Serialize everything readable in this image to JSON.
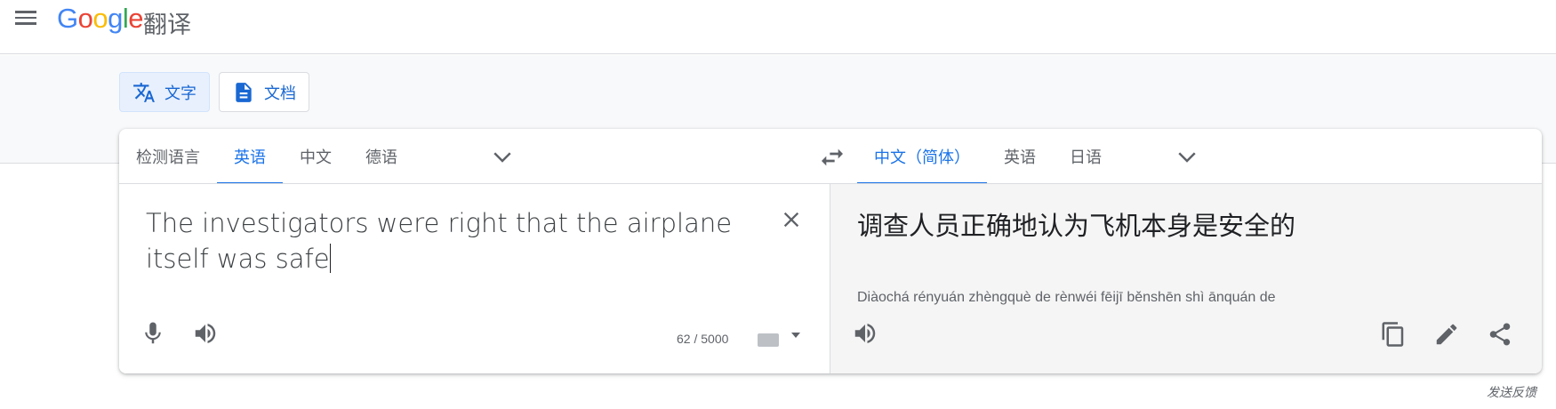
{
  "header": {
    "logo_text": "Google",
    "logo_letters": [
      "G",
      "o",
      "o",
      "g",
      "l",
      "e"
    ],
    "product_name": "翻译"
  },
  "modes": {
    "text_label": "文字",
    "document_label": "文档"
  },
  "source": {
    "languages": [
      "检测语言",
      "英语",
      "中文",
      "德语"
    ],
    "active_language": "英语",
    "text": "The investigators were right that the airplane itself was safe",
    "char_count": "62 / 5000"
  },
  "target": {
    "languages": [
      "中文（简体）",
      "英语",
      "日语"
    ],
    "active_language": "中文（简体）",
    "text": "调查人员正确地认为飞机本身是安全的",
    "pinyin": "Diàochá rényuán zhèngquè de rènwéi fēijī běnshēn shì ānquán de"
  },
  "footer": {
    "feedback_label": "发送反馈"
  },
  "icons": {
    "menu": "menu-icon",
    "translate": "translate-icon",
    "document": "document-icon",
    "swap": "swap-icon",
    "chevron": "chevron-down-icon",
    "clear": "close-icon",
    "mic": "mic-icon",
    "speaker": "speaker-icon",
    "keyboard": "keyboard-icon",
    "copy": "copy-icon",
    "edit": "pencil-icon",
    "share": "share-icon"
  },
  "colors": {
    "accent": "#1a73e8",
    "active_bg": "#e8f0fe",
    "target_pane_bg": "#f5f5f5",
    "band_bg": "#f8f9fa"
  }
}
